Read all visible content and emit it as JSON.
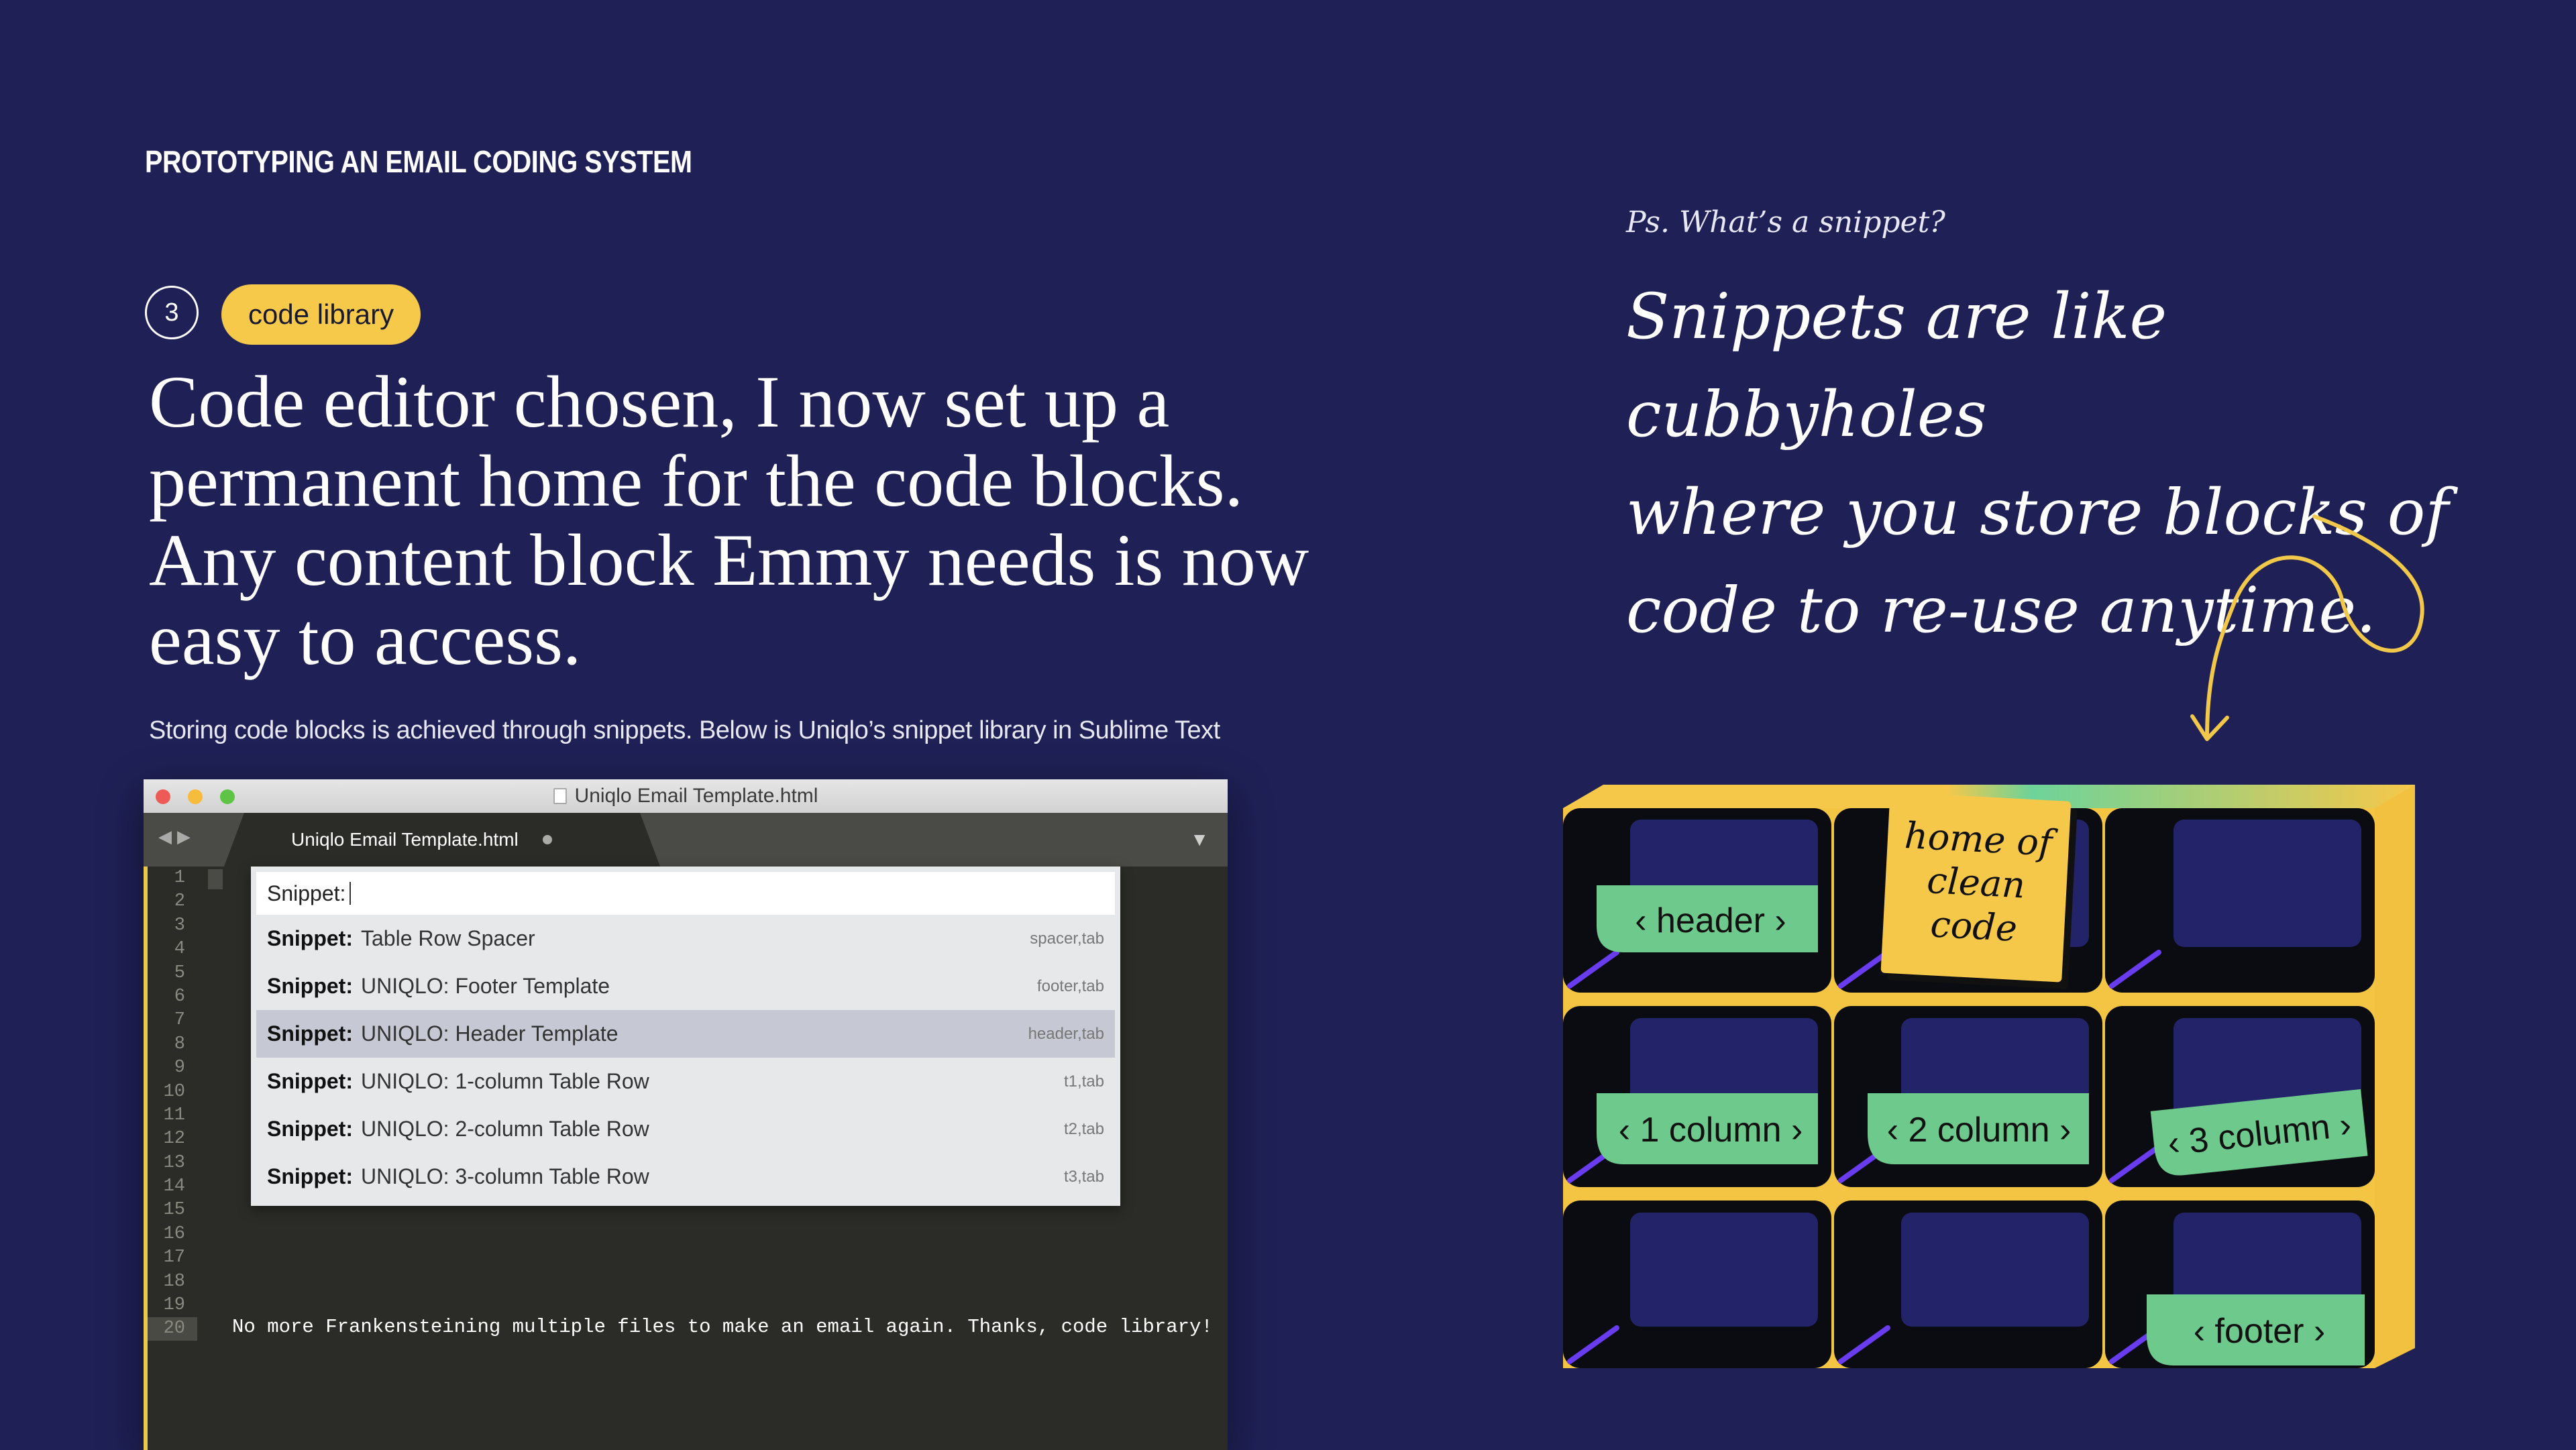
{
  "eyebrow": "PROTOTYPING AN EMAIL CODING SYSTEM",
  "step": {
    "number": "3",
    "tag": "code library"
  },
  "headline": "Code editor chosen, I now set up a permanent home for the code blocks. Any content block Emmy needs is now easy to access.",
  "caption": "Storing code blocks is achieved through snippets. Below is Uniqlo’s snippet library in Sublime Text",
  "editor": {
    "window_title": "Uniqlo Email Template.html",
    "tab_label": "Uniqlo Email Template.html",
    "line_numbers": [
      "1",
      "2",
      "3",
      "4",
      "5",
      "6",
      "7",
      "8",
      "9",
      "10",
      "11",
      "12",
      "13",
      "14",
      "15",
      "16",
      "17",
      "18",
      "19",
      "20"
    ],
    "line20_text": "No more Frankensteining multiple files to make an email again. Thanks, code library!",
    "palette": {
      "input_label": "Snippet:",
      "items": [
        {
          "prefix": "Snippet:",
          "name": "Table Row Spacer",
          "trigger": "spacer,tab",
          "selected": false
        },
        {
          "prefix": "Snippet:",
          "name": "UNIQLO: Footer Template",
          "trigger": "footer,tab",
          "selected": false
        },
        {
          "prefix": "Snippet:",
          "name": "UNIQLO: Header Template",
          "trigger": "header,tab",
          "selected": true
        },
        {
          "prefix": "Snippet:",
          "name": "UNIQLO: 1-column Table Row",
          "trigger": "t1,tab",
          "selected": false
        },
        {
          "prefix": "Snippet:",
          "name": "UNIQLO: 2-column Table Row",
          "trigger": "t2,tab",
          "selected": false
        },
        {
          "prefix": "Snippet:",
          "name": "UNIQLO: 3-column Table Row",
          "trigger": "t3,tab",
          "selected": false
        }
      ]
    }
  },
  "aside": {
    "ps": "Ps. What’s a snippet?",
    "lines": [
      "Snippets are like cubbyholes",
      "where you store blocks of",
      "code to re-use anytime."
    ]
  },
  "cubby": {
    "sticky_note": [
      "home of",
      "clean",
      "code"
    ],
    "labels": {
      "header": "‹ header ›",
      "col1": "‹ 1 column ›",
      "col2": "‹ 2 column ›",
      "col3": "‹ 3 column ›",
      "footer": "‹ footer ›"
    }
  },
  "colors": {
    "background": "#1f2055",
    "accent_yellow": "#f7c94a",
    "label_green": "#6dc98c",
    "purple_stroke": "#6a3cf0"
  }
}
